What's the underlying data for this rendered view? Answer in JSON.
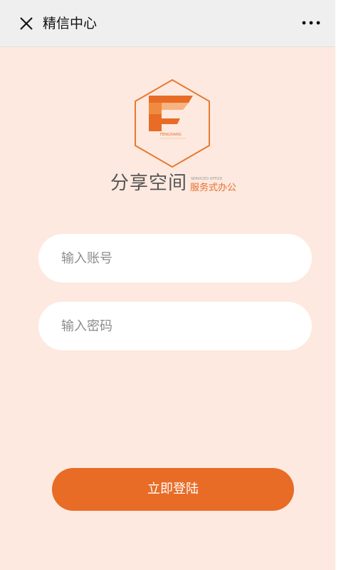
{
  "navbar": {
    "title": "精信中心",
    "close_icon": "close-icon",
    "more_icon": "more-icon"
  },
  "brand": {
    "logo_icon": "hexagon-f-logo",
    "logo_small_text": "FENGXIANG",
    "name": "分享空间",
    "english": "SERVICED OFFICE",
    "tagline": "服务式办公"
  },
  "form": {
    "account_placeholder": "输入账号",
    "password_placeholder": "输入密码",
    "login_label": "立即登陆"
  },
  "colors": {
    "background": "#fde9df",
    "accent": "#e86c26",
    "navbar": "#efefef"
  }
}
